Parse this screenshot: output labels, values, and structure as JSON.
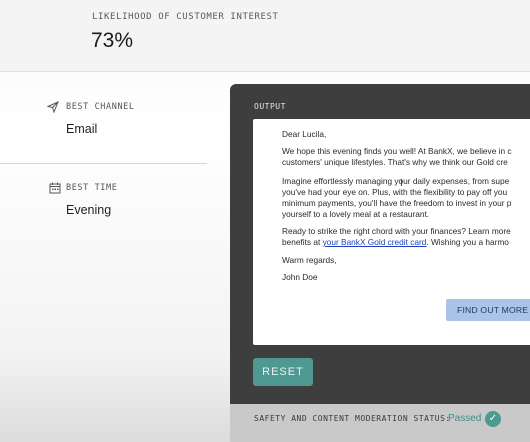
{
  "likelihood": {
    "label": "LIKELIHOOD OF CUSTOMER INTEREST",
    "value": "73%"
  },
  "best_channel": {
    "label": "BEST CHANNEL",
    "value": "Email",
    "icon": "send-icon"
  },
  "best_time": {
    "label": "BEST TIME",
    "value": "Evening",
    "icon": "calendar-icon"
  },
  "output": {
    "label": "OUTPUT",
    "greeting": "Dear Lucila,",
    "para1_line1": "We hope this evening finds you well! At BankX, we believe in c",
    "para1_line2": "customers' unique lifestyles. That's why we think our Gold cre",
    "para2_line1": "Imagine effortlessly managing your daily expenses, from supe",
    "para2_line2": "you've had your eye on. Plus, with the flexibility to pay off you",
    "para2_line3": "minimum payments, you'll have the freedom to invest in your p",
    "para2_line4": "yourself to a lovely meal at a restaurant.",
    "para3_line1": "Ready to strike the right chord with your finances? Learn more",
    "para3_line2_pre": "benefits at ",
    "para3_link": "your BankX Gold credit card",
    "para3_line2_post": ". Wishing you a harmo",
    "closing": "Warm regards,",
    "signature": "John Doe",
    "cta_label": "FIND OUT MORE"
  },
  "reset_label": "RESET",
  "moderation": {
    "label": "SAFETY AND CONTENT MODERATION STATUS:",
    "value": "Passed",
    "icon": "check-circle-icon"
  },
  "colors": {
    "accent_teal": "#4e9a93",
    "panel_dark": "#3e3e3e",
    "cta_blue": "#a9c4e6",
    "link_blue": "#2040c0"
  }
}
